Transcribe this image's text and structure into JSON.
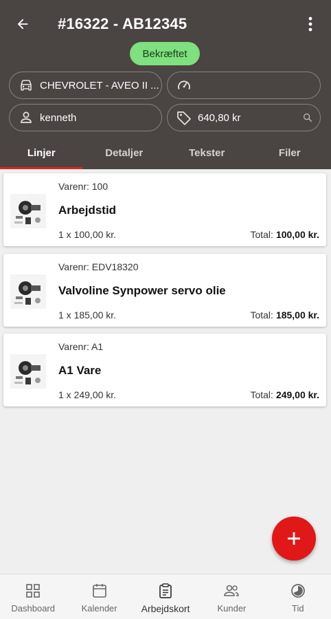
{
  "header": {
    "title": "#16322 - AB12345",
    "status_badge": "Bekræftet",
    "vehicle": "CHEVROLET - AVEO II ...",
    "odometer": "",
    "customer": "kenneth",
    "price": "640,80 kr"
  },
  "tabs": [
    {
      "label": "Linjer",
      "active": true
    },
    {
      "label": "Detaljer",
      "active": false
    },
    {
      "label": "Tekster",
      "active": false
    },
    {
      "label": "Filer",
      "active": false
    }
  ],
  "lines": [
    {
      "varenr": "Varenr: 100",
      "name": "Arbejdstid",
      "qty": "1 x 100,00 kr.",
      "total_label": "Total:",
      "total": "100,00 kr."
    },
    {
      "varenr": "Varenr: EDV18320",
      "name": "Valvoline Synpower servo olie",
      "qty": "1 x 185,00 kr.",
      "total_label": "Total:",
      "total": "185,00 kr."
    },
    {
      "varenr": "Varenr: A1",
      "name": "A1 Vare",
      "qty": "1 x 249,00 kr.",
      "total_label": "Total:",
      "total": "249,00 kr."
    }
  ],
  "bottom_nav": [
    {
      "label": "Dashboard",
      "icon": "dashboard-icon",
      "active": false
    },
    {
      "label": "Kalender",
      "icon": "calendar-icon",
      "active": false
    },
    {
      "label": "Arbejdskort",
      "icon": "clipboard-icon",
      "active": true
    },
    {
      "label": "Kunder",
      "icon": "people-icon",
      "active": false
    },
    {
      "label": "Tid",
      "icon": "clock-icon",
      "active": false
    }
  ],
  "colors": {
    "header_bg": "#4a4442",
    "accent": "#e01818",
    "badge_bg": "#7ee07e"
  }
}
